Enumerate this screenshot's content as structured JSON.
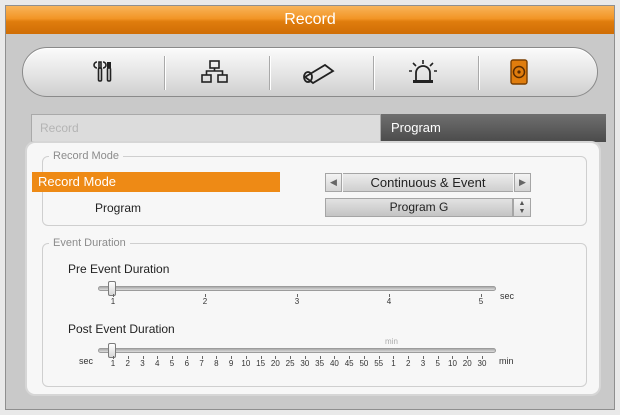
{
  "window": {
    "title": "Record"
  },
  "toolbar": {
    "items": [
      {
        "icon": "tools-icon",
        "active": false
      },
      {
        "icon": "network-icon",
        "active": false
      },
      {
        "icon": "camera-icon",
        "active": false
      },
      {
        "icon": "alarm-icon",
        "active": false
      },
      {
        "icon": "hdd-record-icon",
        "active": true
      }
    ]
  },
  "tabs": [
    {
      "label": "Record",
      "active": false
    },
    {
      "label": "Program",
      "active": true
    }
  ],
  "record_mode": {
    "legend": "Record Mode",
    "mode_label": "Record Mode",
    "mode_value": "Continuous & Event",
    "program_label": "Program",
    "program_value": "Program G"
  },
  "event_duration": {
    "legend": "Event Duration",
    "pre": {
      "label": "Pre Event Duration",
      "ticks": [
        "1",
        "2",
        "3",
        "4",
        "5"
      ],
      "unit": "sec",
      "value": "1"
    },
    "post": {
      "label": "Post Event Duration",
      "left_unit": "sec",
      "mid_unit": "min",
      "unit": "min",
      "ticks": [
        "1",
        "2",
        "3",
        "4",
        "5",
        "6",
        "7",
        "8",
        "9",
        "10",
        "15",
        "20",
        "25",
        "30",
        "35",
        "40",
        "45",
        "50",
        "55",
        "1",
        "2",
        "3",
        "5",
        "10",
        "20",
        "30"
      ],
      "value": "1"
    }
  },
  "colors": {
    "accent": "#ee8a15",
    "title_bar": "#f29526",
    "tab_active": "#5a5a5a"
  }
}
